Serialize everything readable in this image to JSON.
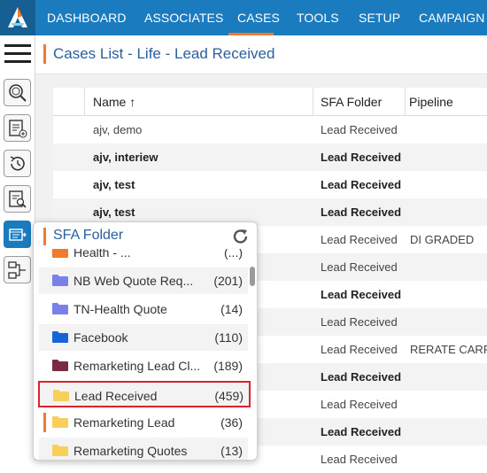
{
  "nav": {
    "items": [
      "DASHBOARD",
      "ASSOCIATES",
      "CASES",
      "TOOLS",
      "SETUP",
      "CAMPAIGN"
    ],
    "active": "CASES",
    "accent": "#f07a2d",
    "bar_color": "#1a7bbf"
  },
  "sidebar": {
    "icons": [
      "menu-icon",
      "search-icon",
      "add-document-icon",
      "history-icon",
      "document-search-icon",
      "sfa-folder-icon",
      "workflow-icon"
    ]
  },
  "page": {
    "title": "Cases List - Life - Lead Received"
  },
  "table": {
    "columns": [
      "Name ↑",
      "SFA Folder",
      "Pipeline"
    ],
    "rows": [
      {
        "name": "ajv, demo",
        "folder": "Lead Received",
        "pipeline": "",
        "bold": false
      },
      {
        "name": "ajv, interiew",
        "folder": "Lead Received",
        "pipeline": "",
        "bold": true
      },
      {
        "name": "ajv, test",
        "folder": "Lead Received",
        "pipeline": "",
        "bold": true
      },
      {
        "name": "ajv, test",
        "folder": "Lead Received",
        "pipeline": "",
        "bold": true
      },
      {
        "name": "",
        "folder": "Lead Received",
        "pipeline": "DI GRADED",
        "bold": false
      },
      {
        "name": "",
        "folder": "Lead Received",
        "pipeline": "",
        "bold": false
      },
      {
        "name": "",
        "folder": "Lead Received",
        "pipeline": "",
        "bold": true
      },
      {
        "name": "",
        "folder": "Lead Received",
        "pipeline": "",
        "bold": false
      },
      {
        "name": "",
        "folder": "Lead Received",
        "pipeline": "RERATE CARRIE",
        "bold": false
      },
      {
        "name": "",
        "folder": "Lead Received",
        "pipeline": "",
        "bold": true
      },
      {
        "name": "",
        "folder": "Lead Received",
        "pipeline": "",
        "bold": false
      },
      {
        "name": "",
        "folder": "Lead Received",
        "pipeline": "",
        "bold": true
      },
      {
        "name": "",
        "folder": "Lead Received",
        "pipeline": "",
        "bold": false
      }
    ]
  },
  "sfa_popup": {
    "title": "SFA Folder",
    "folders": [
      {
        "name": "Health - ...",
        "count": "(...)",
        "color": "#f07a2d"
      },
      {
        "name": "NB Web Quote Req...",
        "count": "(201)",
        "color": "#7b7fe8"
      },
      {
        "name": "TN-Health Quote",
        "count": "(14)",
        "color": "#7b7fe8"
      },
      {
        "name": "Facebook",
        "count": "(110)",
        "color": "#1565d8"
      },
      {
        "name": "Remarketing Lead Cl...",
        "count": "(189)",
        "color": "#7a2a45"
      },
      {
        "name": "Lead Received",
        "count": "(459)",
        "color": "#f7cf5a",
        "selected": true
      },
      {
        "name": "Remarketing Lead",
        "count": "(36)",
        "color": "#f7cf5a",
        "marker": true
      },
      {
        "name": "Remarketing Quotes",
        "count": "(13)",
        "color": "#f7cf5a"
      }
    ]
  }
}
